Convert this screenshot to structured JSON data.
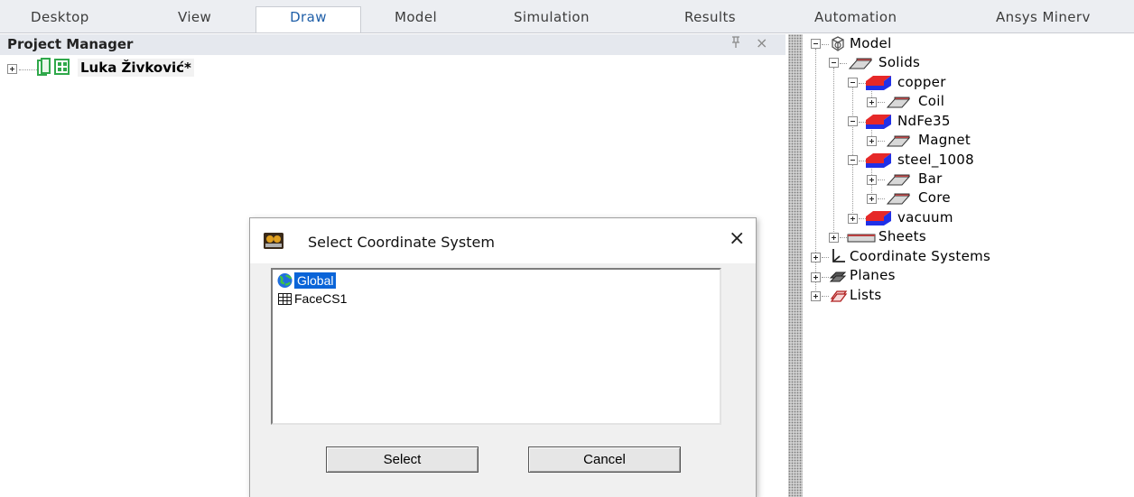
{
  "ribbon": {
    "tabs": [
      {
        "label": "Desktop"
      },
      {
        "label": "View"
      },
      {
        "label": "Draw"
      },
      {
        "label": "Model"
      },
      {
        "label": "Simulation"
      },
      {
        "label": "Results"
      },
      {
        "label": "Automation"
      },
      {
        "label": "Ansys Minerv"
      }
    ],
    "active_tab": "Draw"
  },
  "project_manager": {
    "title": "Project Manager",
    "pin_icon": "pin-icon",
    "close_glyph": "×",
    "project_name": "Luka Živković*"
  },
  "model_tree": {
    "model": "Model",
    "solids": "Solids",
    "materials": [
      {
        "name": "copper",
        "objects": [
          "Coil"
        ]
      },
      {
        "name": "NdFe35",
        "objects": [
          "Magnet"
        ]
      },
      {
        "name": "steel_1008",
        "objects": [
          "Bar",
          "Core"
        ]
      },
      {
        "name": "vacuum",
        "objects": []
      }
    ],
    "sheets": "Sheets",
    "coordinate_systems": "Coordinate Systems",
    "planes": "Planes",
    "lists": "Lists"
  },
  "dialog": {
    "title": "Select Coordinate System",
    "close_glyph": "×",
    "items": [
      {
        "label": "Global",
        "selected": true,
        "icon": "globe-icon"
      },
      {
        "label": "FaceCS1",
        "selected": false,
        "icon": "grid-icon"
      }
    ],
    "select_label": "Select",
    "cancel_label": "Cancel"
  },
  "colors": {
    "ribbon_bg": "#eceef2",
    "active_tab_text": "#1f5fa8",
    "selection": "#0a64d8",
    "project_icon_green": "#2fa84a"
  }
}
